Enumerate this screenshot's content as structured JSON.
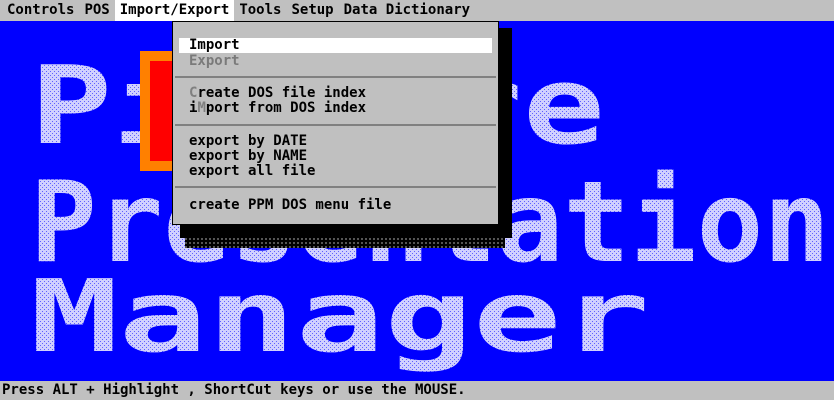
{
  "menubar": {
    "items": [
      {
        "label": "Controls",
        "active": false
      },
      {
        "label": "POS",
        "active": false
      },
      {
        "label": "Import/Export",
        "active": true
      },
      {
        "label": "Tools",
        "active": false
      },
      {
        "label": "Setup",
        "active": false
      },
      {
        "label": "Data Dictionary",
        "active": false
      }
    ]
  },
  "dropdown": {
    "items": [
      {
        "label": "Import",
        "highlighted": true
      },
      {
        "label": "Export",
        "disabled": true
      },
      {
        "label": "Create DOS file index",
        "hotkey_prefix": "C",
        "rest": "reate DOS file index"
      },
      {
        "label": "iMport from DOS index",
        "pre": "i",
        "hotkey": "M",
        "post": "port from DOS index"
      },
      {
        "label": "export by DATE"
      },
      {
        "label": "export by NAME"
      },
      {
        "label": "export all file"
      },
      {
        "label": "create PPM DOS menu file"
      }
    ]
  },
  "banner": {
    "lines": [
      "Picture",
      "Presentation",
      "Manager"
    ],
    "text_color": "#c8c8ff",
    "background": "#0000ff"
  },
  "statusbar": {
    "text": "Press ALT + Highlight , ShortCut keys or use the MOUSE."
  },
  "colors": {
    "menu_bg": "#c0c0c0",
    "screen_bg": "#0000ff",
    "highlight": "#ffffff"
  }
}
